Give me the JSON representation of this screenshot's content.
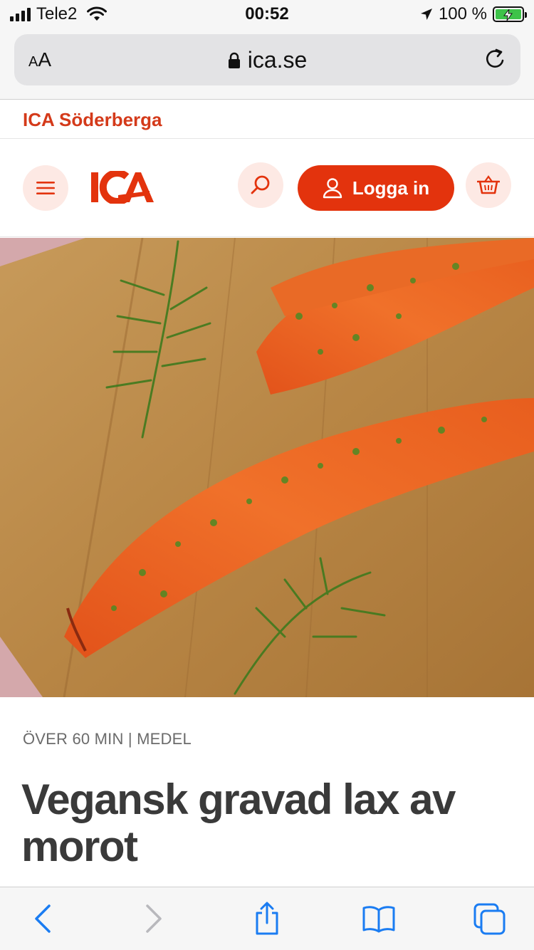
{
  "status_bar": {
    "carrier": "Tele2",
    "time": "00:52",
    "battery": "100 %",
    "battery_level": 1.0
  },
  "browser": {
    "text_size_label_small": "A",
    "text_size_label_large": "A",
    "url": "ica.se"
  },
  "store": {
    "name": "ICA Söderberga"
  },
  "header": {
    "logo_text": "ICA",
    "login_label": "Logga in"
  },
  "recipe": {
    "meta": "ÖVER 60 MIN | MEDEL",
    "title": "Vegansk gravad lax av morot"
  },
  "colors": {
    "brand_red": "#e3330d",
    "store_red": "#d43a1a",
    "button_tint": "#fde9e4",
    "ios_blue": "#1a7cf2"
  },
  "icons": {
    "menu": "hamburger-icon",
    "search": "search-icon",
    "user": "user-icon",
    "basket": "basket-icon",
    "back": "chevron-left-icon",
    "forward": "chevron-right-icon",
    "share": "share-icon",
    "bookmarks": "book-icon",
    "tabs": "tabs-icon"
  }
}
